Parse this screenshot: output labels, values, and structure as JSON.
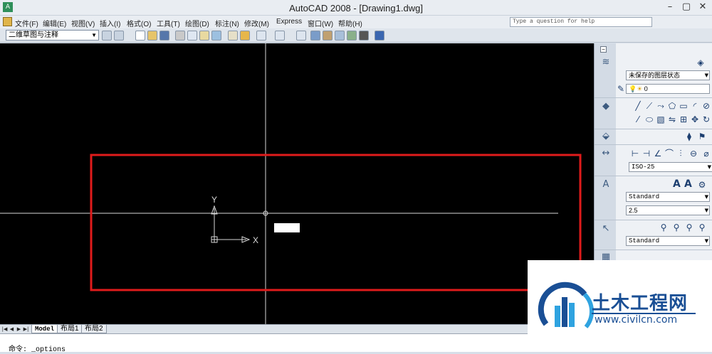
{
  "window": {
    "title": "AutoCAD 2008 - [Drawing1.dwg]",
    "app_icon_text": "A",
    "minimize": "–",
    "restore": "▢",
    "close": "✕"
  },
  "menu": {
    "items": [
      "文件(F)",
      "编辑(E)",
      "视图(V)",
      "插入(I)",
      "格式(O)",
      "工具(T)",
      "绘图(D)",
      "标注(N)",
      "修改(M)",
      "Express",
      "窗口(W)",
      "帮助(H)"
    ],
    "help_placeholder": "Type a question for help"
  },
  "toolbar": {
    "workspace": "二维草图与注释"
  },
  "drawing": {
    "background": "#000000",
    "selection_rect_color": "#e01b1b",
    "ucs_x_label": "X",
    "ucs_y_label": "Y"
  },
  "layout_tabs": {
    "tabs": [
      "Model",
      "布局1",
      "布局2"
    ],
    "active": "Model"
  },
  "command": {
    "prefix": "命令:",
    "text": "_options"
  },
  "panel": {
    "layer_state": "未保存的图层状态",
    "layer_name": "0",
    "dim_style": "ISO-25",
    "text_style": "Standard",
    "text_height": "2.5",
    "multileader_style": "Standard"
  },
  "watermark": {
    "title": "土木工程网",
    "url": "www.civilcn.com"
  }
}
